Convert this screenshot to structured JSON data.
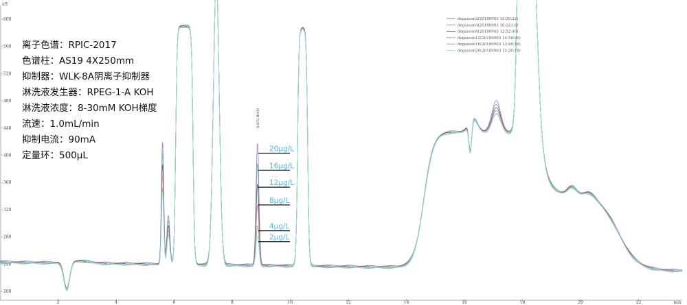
{
  "chart_data": {
    "type": "line",
    "title": "",
    "y_unit": "uS",
    "x_unit": "min",
    "xlim": [
      0,
      23.5
    ],
    "ylim": [
      187,
      620
    ],
    "x_ticks": [
      2,
      4,
      6,
      8,
      10,
      12,
      14,
      16,
      18,
      20,
      22
    ],
    "y_ticks": [
      200,
      240,
      280,
      320,
      360,
      400,
      440,
      480,
      520,
      560,
      600
    ],
    "legend_position": "top-right",
    "series": [
      {
        "name": "degasson2(20180903 15:29:22)",
        "color": "#7b86c8",
        "scale": 1.0
      },
      {
        "name": "degasson4(20180903 16:32:18)",
        "color": "#8aa0a6",
        "scale": 0.8
      },
      {
        "name": "degasson8(20180903 12:52:40)",
        "color": "#5a5a5a",
        "scale": 0.6
      },
      {
        "name": "degasson12(20180903 14:58:06)",
        "color": "#e07b9a",
        "scale": 0.4
      },
      {
        "name": "degasson16(20180903 13:48:16)",
        "color": "#7ac07a",
        "scale": 0.2
      },
      {
        "name": "degasson20(20180903 14:26:18)",
        "color": "#9be0f0",
        "scale": 0.1
      }
    ],
    "peak_label": {
      "text": "8.872  BrO3",
      "x": 8.87
    },
    "concentration_levels": [
      {
        "label": "20μg/L",
        "y": 403
      },
      {
        "label": "16μg/L",
        "y": 378
      },
      {
        "label": "12μg/L",
        "y": 353
      },
      {
        "label": "8μg/L",
        "y": 327
      },
      {
        "label": "4μg/L",
        "y": 289
      },
      {
        "label": "2μg/L",
        "y": 273
      }
    ]
  },
  "conditions": [
    "离子色谱：RPIC-2017",
    "色谱柱：AS19 4X250mm",
    "抑制器：WLK-8A阴离子抑制器",
    "淋洗液发生器：RPEG-1-A KOH",
    "淋洗液浓度：8-30mM KOH梯度",
    "流速：1.0mL/min",
    "抑制电流：90mA",
    "定量环：500μL"
  ]
}
